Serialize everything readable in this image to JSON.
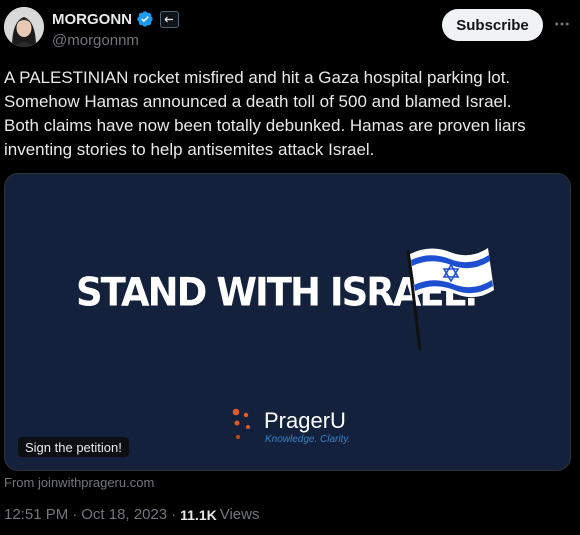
{
  "author": {
    "display_name": "MORGONN",
    "handle": "@morgonnm",
    "verified": true
  },
  "actions": {
    "subscribe_label": "Subscribe",
    "more_icon": "more-horizontal-icon"
  },
  "tweet": {
    "text": "A PALESTINIAN rocket misfired and hit a Gaza hospital parking lot.\nSomehow Hamas announced a death toll of 500 and blamed Israel.\nBoth claims have now been totally debunked. Hamas are proven liars\ninventing stories to help antisemites attack Israel."
  },
  "card": {
    "headline": "STAND WITH ISRAEL.",
    "brand_name": "PragerU",
    "brand_tagline": "Knowledge. Clarity.",
    "badge_label": "Sign the petition!",
    "source": "From joinwithprageru.com",
    "background_color": "#13213c"
  },
  "meta": {
    "time": "12:51 PM",
    "separator": "·",
    "date": "Oct 18, 2023",
    "separator2": "·",
    "views_count": "11.1K",
    "views_label": "Views"
  },
  "colors": {
    "verified_blue": "#1d9bf0",
    "muted_text": "#71767b",
    "flag_blue": "#1f4fd1",
    "brand_orange": "#e05a2b"
  }
}
